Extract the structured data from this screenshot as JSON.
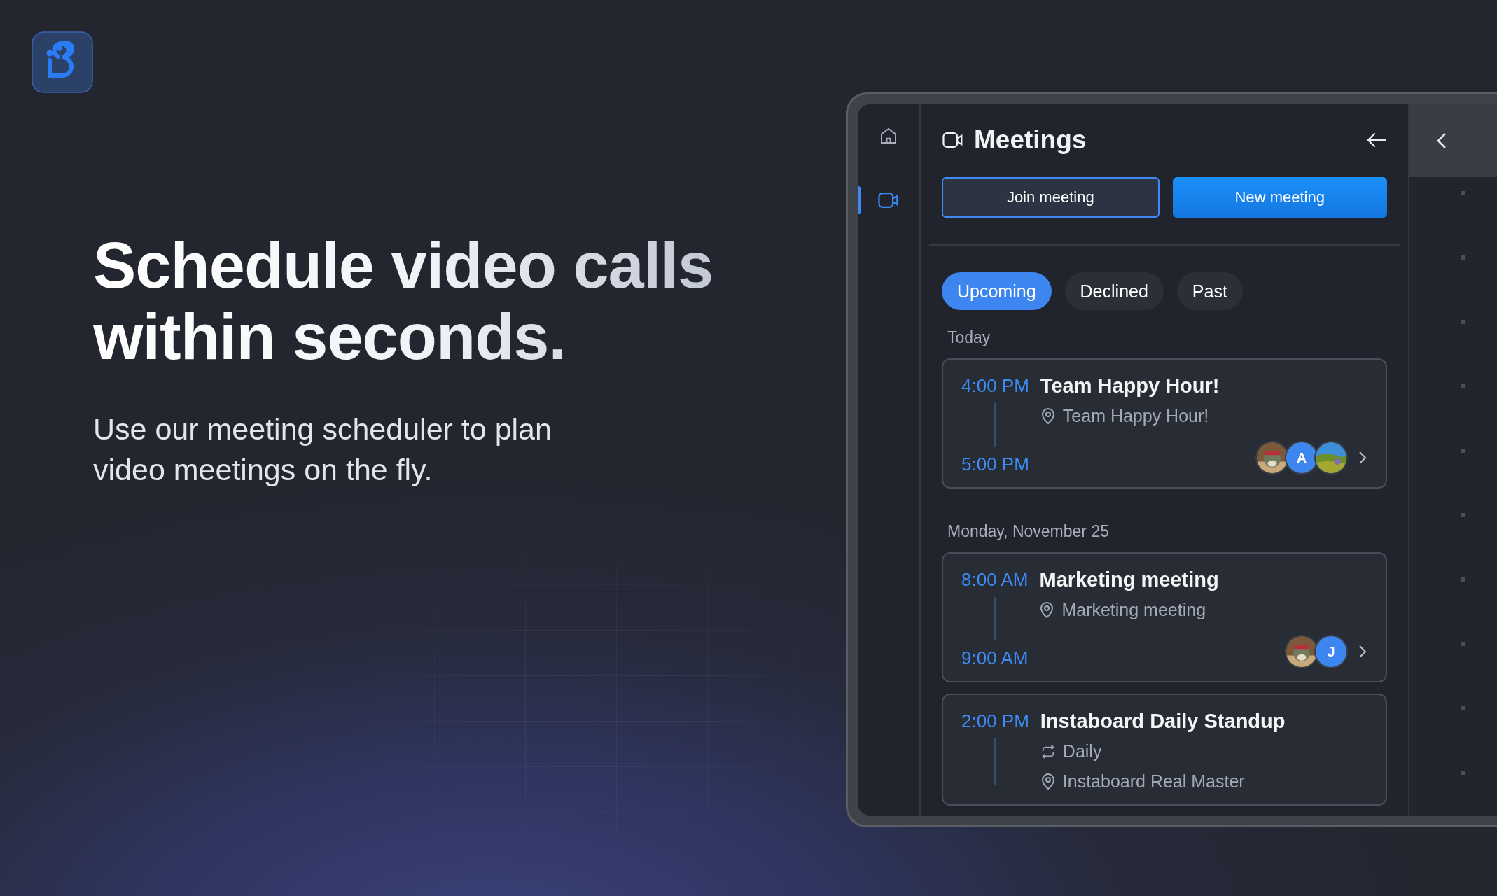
{
  "hero": {
    "headline": "Schedule video calls within seconds.",
    "subtitle": "Use our meeting scheduler to plan video meetings on the fly."
  },
  "sidebar": {
    "items": [
      {
        "kind": "home",
        "selected": false
      },
      {
        "kind": "video",
        "selected": true
      }
    ]
  },
  "panel": {
    "title": "Meetings",
    "buttons": [
      {
        "label": "Join meeting",
        "kind": "outline"
      },
      {
        "label": "New meeting",
        "kind": "primary"
      }
    ],
    "tabs": [
      {
        "label": "Upcoming",
        "selected": true
      },
      {
        "label": "Declined",
        "selected": false
      },
      {
        "label": "Past",
        "selected": false
      }
    ],
    "groups": [
      {
        "label": "Today",
        "meetings": [
          {
            "start": "4:00 PM",
            "end": "5:00 PM",
            "title": "Team Happy Hour!",
            "location": "Team Happy Hour!",
            "attendees": [
              {
                "kind": "picture"
              },
              {
                "kind": "initial",
                "initial": "A"
              },
              {
                "kind": "picture"
              }
            ]
          }
        ]
      },
      {
        "label": "Monday, November 25",
        "meetings": [
          {
            "start": "8:00 AM",
            "end": "9:00 AM",
            "title": "Marketing meeting",
            "location": "Marketing meeting",
            "attendees": [
              {
                "kind": "picture"
              },
              {
                "kind": "initial",
                "initial": "J"
              }
            ]
          },
          {
            "start": "2:00 PM",
            "title": "Instaboard Daily Standup",
            "recurrence": "Daily",
            "location": "Instaboard Real Master"
          }
        ]
      }
    ]
  }
}
